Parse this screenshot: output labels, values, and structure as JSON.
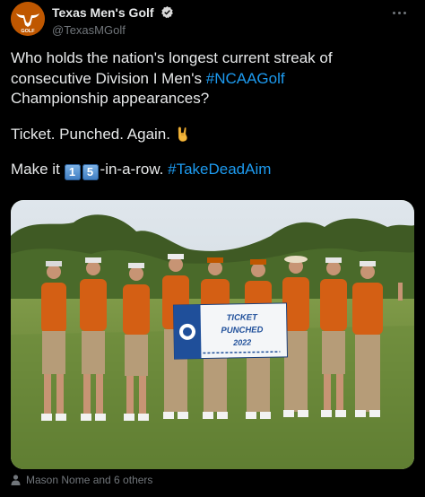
{
  "account": {
    "name": "Texas Men's Golf",
    "handle": "@TexasMGolf",
    "avatar_text": "GOLF",
    "verified": true
  },
  "tweet": {
    "line1": "Who holds the nation's longest current streak of",
    "line2_prefix": "consecutive Division I Men's ",
    "hashtag_ncaa": "#NCAAGolf",
    "line3": "Championship appearances?",
    "line4": "Ticket. Punched. Again.",
    "line4_emoji": "sign-of-the-horns",
    "line5_prefix": "Make it ",
    "keycap_1": "1",
    "keycap_2": "5",
    "line5_suffix": "-in-a-row. ",
    "hashtag_aim": "#TakeDeadAim"
  },
  "photo": {
    "banner_line1": "TICKET",
    "banner_line2": "PUNCHED",
    "banner_line3": "2022"
  },
  "footer": {
    "tagged": "Mason Nome and 6 others"
  },
  "colors": {
    "background": "#000000",
    "text": "#e7e9ea",
    "muted": "#71767b",
    "link": "#1d9bf0",
    "burnt_orange": "#bf5700"
  }
}
